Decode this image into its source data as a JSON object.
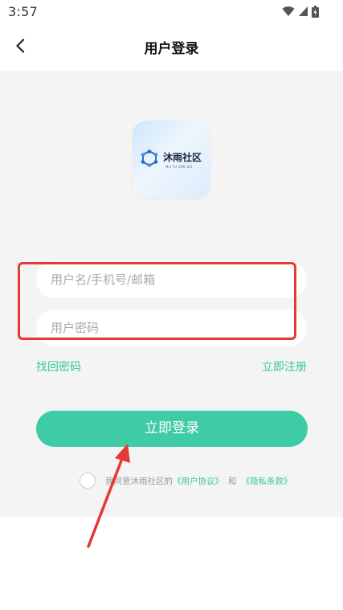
{
  "status_bar": {
    "time": "3:57",
    "icons": [
      "wifi-icon",
      "signal-icon",
      "battery-icon"
    ]
  },
  "header": {
    "back_icon": "chevron-left-icon",
    "title": "用户登录"
  },
  "logo": {
    "name": "沐雨社区",
    "subtitle": "MU YU SHE QU"
  },
  "form": {
    "username_placeholder": "用户名/手机号/邮箱",
    "username_value": "",
    "password_placeholder": "用户密码",
    "password_value": "",
    "forgot_label": "找回密码",
    "register_label": "立即注册",
    "login_label": "立即登录"
  },
  "agreement": {
    "checked": false,
    "text": "我同意沐雨社区的",
    "user_agreement": "《用户协议》",
    "and": "和",
    "privacy_policy": "《隐私条款》"
  },
  "colors": {
    "accent": "#3ecba5",
    "link": "#36c69e",
    "annotation": "#e53935",
    "background": "#f4f4f4"
  }
}
